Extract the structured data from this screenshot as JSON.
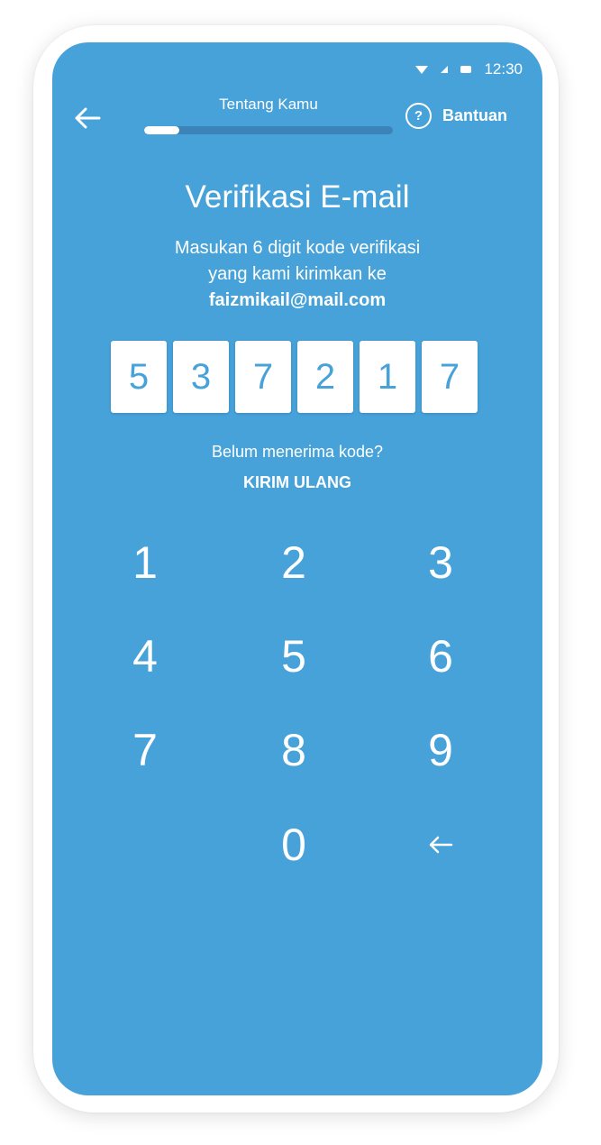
{
  "status_bar": {
    "time": "12:30"
  },
  "header": {
    "step_title": "Tentang Kamu",
    "progress": 0.14,
    "help_label": "Bantuan",
    "help_symbol": "?"
  },
  "main": {
    "title": "Verifikasi E-mail",
    "subtitle_line1": "Masukan 6 digit kode verifikasi",
    "subtitle_line2": "yang kami kirimkan ke",
    "email": "faizmikail@mail.com",
    "code_digits": [
      "5",
      "3",
      "7",
      "2",
      "1",
      "7"
    ],
    "resend_hint": "Belum menerima kode?",
    "resend_label": "KIRIM ULANG"
  },
  "keypad": {
    "keys": [
      "1",
      "2",
      "3",
      "4",
      "5",
      "6",
      "7",
      "8",
      "9",
      "0"
    ],
    "backspace_icon": "backspace-arrow-icon"
  },
  "colors": {
    "background": "#47a2d9",
    "progress_track": "#3c84b8",
    "digit_text": "#47a2d9"
  }
}
